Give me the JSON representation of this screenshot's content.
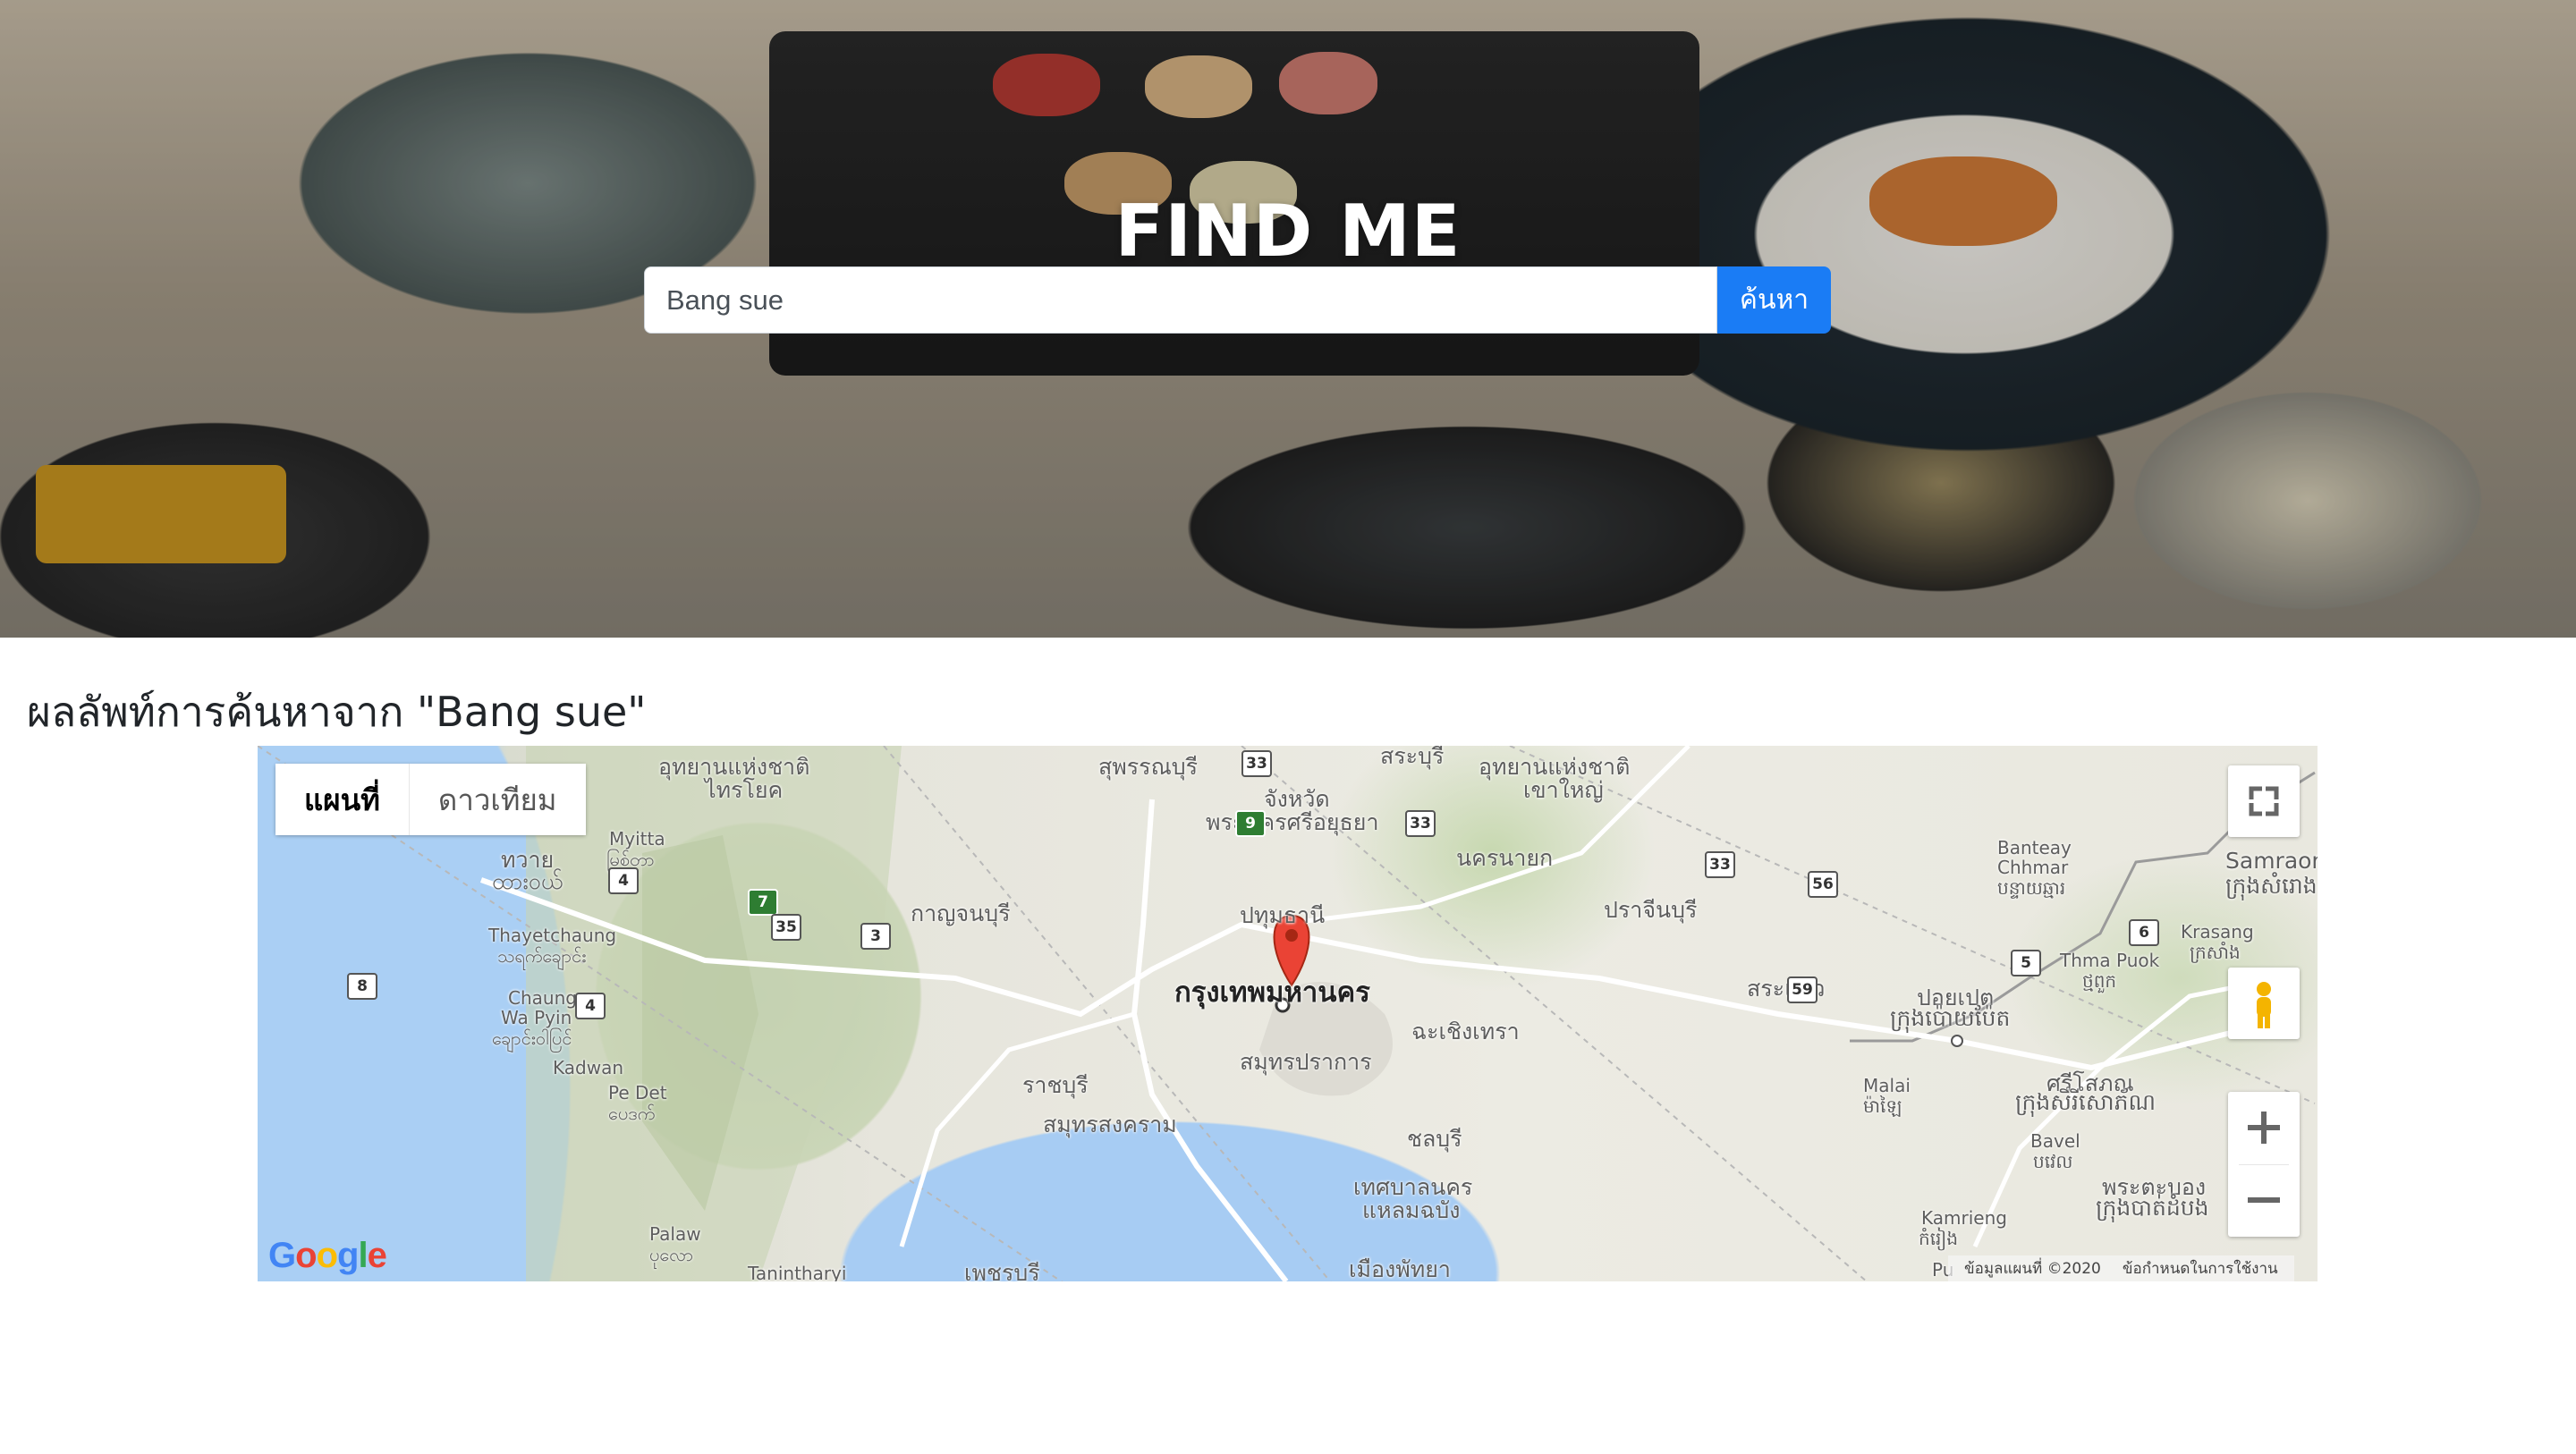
{
  "hero": {
    "title": "FIND ME",
    "search_value": "Bang sue",
    "search_button_label": "ค้นหา"
  },
  "results": {
    "heading": "ผลลัพท์การค้นหาจาก \"Bang sue\""
  },
  "map": {
    "type_buttons": {
      "map": "แผนที่",
      "satellite": "ดาวเทียม"
    },
    "labels": {
      "l1": "อุทยานแห่งชาติ",
      "l2": "ไทรโยค",
      "l3": "สุพรรณบุรี",
      "l4": "จังหวัด",
      "l5": "พระนครศรีอยุธยา",
      "l6": "สระบุรี",
      "l7": "อุทยานแห่งชาติ",
      "l8": "เขาใหญ่",
      "l9": "นครนายก",
      "l10": "ปราจีนบุรี",
      "l11": "กาญจนบุรี",
      "l12": "ปทุมธานี",
      "l13": "กรุงเทพมหานคร",
      "l14": "ฉะเชิงเทรา",
      "l15": "สมุทรปราการ",
      "l16": "ราชบุรี",
      "l17": "สมุทรสงคราม",
      "l18": "ชลบุรี",
      "l19": "เทศบาลนคร",
      "l20": "แหลมฉบัง",
      "l21": "เมืองพัทยา",
      "l22": "เพชรบุรี",
      "l23": "สระแก้ว",
      "l24": "ปอยเปต",
      "l25": "ក្រុងប៉ោយប៉ែត",
      "l26": "Banteay",
      "l27": "Chhmar",
      "l28": "បន្ទាយឆ្មារ",
      "l29": "Samraong",
      "l30": "ក្រុងសំរោង",
      "l31": "Krasang",
      "l32": "ក្រសាំង",
      "l33": "Thma Puok",
      "l34": "ថ្មពួក",
      "l35": "ศรีโสภณ",
      "l36": "ក្រុងសិរីសោភ័ណ",
      "l37": "Malai",
      "l38": "ម៉ាឡៃ",
      "l39": "Bavel",
      "l40": "បវេល",
      "l41": "พระตะบอง",
      "l42": "ក្រុងបាត់ដំបង",
      "l43": "Kamrieng",
      "l44": "កំរៀង",
      "l45": "Myitta",
      "l46": "မြစ်တာ",
      "l47": "ทวาย",
      "l48": "ထားဝယ်",
      "l49": "Thayetchaung",
      "l50": "သရက်ချောင်း",
      "l51": "Chaung",
      "l52": "Wa Pyin",
      "l53": "ချောင်းဝါပြင်",
      "l54": "Kadwan",
      "l55": "Pe Det",
      "l56": "ပေဒက်",
      "l57": "Palaw",
      "l58": "ပုလော",
      "l59": "Tanintharyi",
      "l60": "Pu"
    },
    "route_shields": [
      "33",
      "9",
      "33",
      "33",
      "4",
      "7",
      "35",
      "3",
      "8",
      "4",
      "56",
      "5",
      "6",
      "59"
    ],
    "google_logo": "Google",
    "footer": {
      "data": "ข้อมูลแผนที่ ©2020",
      "terms": "ข้อกำหนดในการใช้งาน"
    },
    "colors": {
      "water": "#aacff4",
      "land": "#e8e8df",
      "park": "#cbd8b6",
      "marker": "#ea4335",
      "road": "#ffffff"
    }
  }
}
